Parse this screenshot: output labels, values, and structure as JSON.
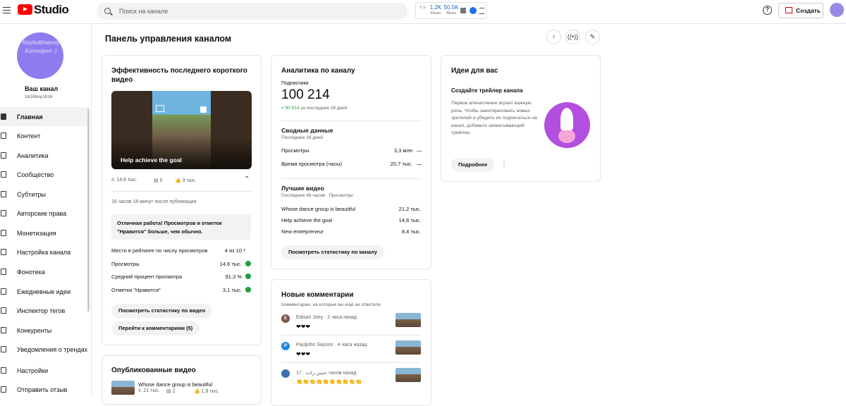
{
  "header": {
    "logo_text": "Studio",
    "search_placeholder": "Поиск на канале",
    "ext": [
      {
        "value": "",
        "sub": "0 1г"
      },
      {
        "value": "1.2K",
        "sub": "60мин"
      },
      {
        "value": "50.5K",
        "sub": "48мин"
      }
    ],
    "help_glyph": "?",
    "create_label": "Создать"
  },
  "sidebar": {
    "avatar_overlay": "Keşfedilmemiş Komedyen :)",
    "channel_title": "Ваш канал",
    "channel_handle": "1616boy1616",
    "items": [
      {
        "label": "Главная",
        "icon": "dashboard-icon"
      },
      {
        "label": "Контент",
        "icon": "content-icon"
      },
      {
        "label": "Аналитика",
        "icon": "analytics-icon"
      },
      {
        "label": "Сообщество",
        "icon": "community-icon"
      },
      {
        "label": "Субтитры",
        "icon": "subtitles-icon"
      },
      {
        "label": "Авторские права",
        "icon": "copyright-icon"
      },
      {
        "label": "Монетизация",
        "icon": "monetization-icon"
      },
      {
        "label": "Настройка канала",
        "icon": "customization-icon"
      },
      {
        "label": "Фонотека",
        "icon": "audio-library-icon"
      },
      {
        "label": "Ежедневные идеи",
        "icon": "daily-ideas-icon"
      },
      {
        "label": "Инспектор тегов",
        "icon": "tag-inspector-icon"
      },
      {
        "label": "Конкуренты",
        "icon": "competitors-icon"
      },
      {
        "label": "Уведомления о трендах",
        "icon": "trend-alerts-icon"
      },
      {
        "label": "Настройки",
        "icon": "settings-icon"
      },
      {
        "label": "Отправить отзыв",
        "icon": "feedback-icon"
      }
    ]
  },
  "main": {
    "title": "Панель управления каналом",
    "latest_short": {
      "title": "Эффективность последнего короткого видео",
      "thumb_title": "Help achieve the goal",
      "views": "14,6 тыс.",
      "comments": "5",
      "likes": "3 тыс.",
      "published": "16 часов 18 минут после публикации",
      "message": "Отличная работа! Просмотров и отметок \"Нравится\" больше, чем обычно.",
      "metrics": [
        {
          "label": "Место в рейтинге по числу просмотров",
          "value": "4 из 10"
        },
        {
          "label": "Просмотры",
          "value": "14,6 тыс."
        },
        {
          "label": "Средний процент просмотра",
          "value": "91,3 %"
        },
        {
          "label": "Отметки \"Нравится\"",
          "value": "3,1 тыс."
        }
      ],
      "btn_stats": "Посмотреть статистику по видео",
      "btn_comments": "Перейти к комментариям (5)"
    },
    "published_videos": {
      "title": "Опубликованные видео",
      "first_title": "Whose dance group is beautiful",
      "first_views": "21 тыс.",
      "first_comments": "2",
      "first_likes": "1,8 тыс."
    },
    "analytics": {
      "title": "Аналитика по каналу",
      "subs_label": "Подписчики",
      "subs_value": "100 214",
      "subs_delta": "+ 90 814",
      "subs_delta_text": "за последние 28 дней",
      "summary_title": "Сводные данные",
      "summary_sub": "Последние 28 дней",
      "summary": [
        {
          "label": "Просмотры",
          "value": "3,3 млн",
          "trend": "—"
        },
        {
          "label": "Время просмотра (часы)",
          "value": "20,7 тыс.",
          "trend": "—"
        }
      ],
      "top_title": "Лучшие видео",
      "top_sub": "Последние 48 часов · Просмотры",
      "top": [
        {
          "label": "Whose dance group is beautiful",
          "value": "21,2 тыс."
        },
        {
          "label": "Help achieve the goal",
          "value": "14,6 тыс."
        },
        {
          "label": "New entrepreneur",
          "value": "8,4 тыс."
        }
      ],
      "btn": "Посмотреть статистику по каналу"
    },
    "comments": {
      "title": "Новые комментарии",
      "sub": "Комментарии, на которые вы ещё не ответили",
      "items": [
        {
          "initial": "E",
          "author": "Edisan Joey",
          "time": "2 часа назад",
          "text": "❤❤❤",
          "color": "#795548"
        },
        {
          "initial": "P",
          "author": "Pauljohn Sayson",
          "time": "4 часа назад",
          "text": "❤❤❤",
          "color": "#1e88e5"
        },
        {
          "initial": "",
          "author": "حسن زاده",
          "time": "17 часов назад",
          "text": "👏👏👏👏👏👏👏👏👏👏",
          "color": "#3f6fb0"
        }
      ]
    },
    "ideas": {
      "title": "Идеи для вас",
      "heading": "Создайте трейлер канала",
      "body": "Первое впечатление играет важную роль. Чтобы заинтересовать новых зрителей и убедить их подписаться на канал, добавьте захватывающий трейлер.",
      "btn": "Подробнее"
    }
  }
}
